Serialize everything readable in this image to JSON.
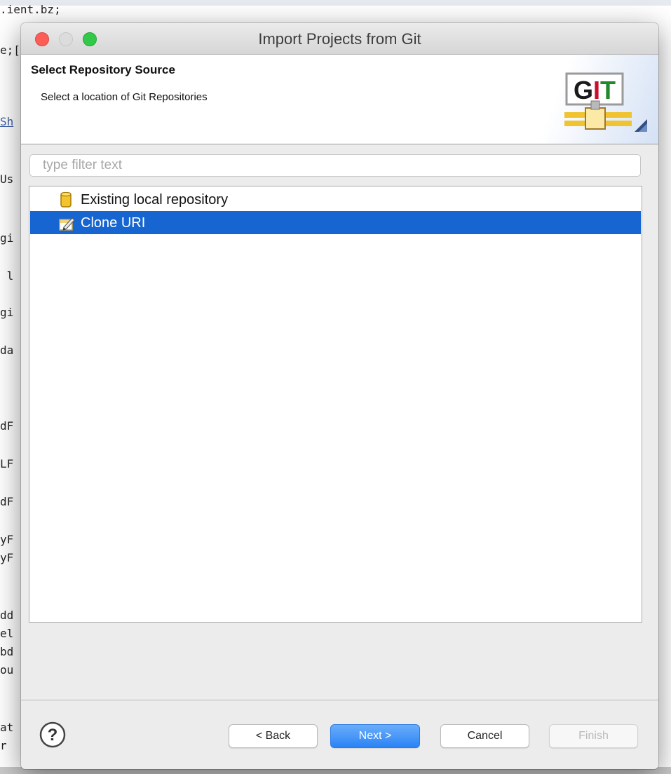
{
  "background_editor": {
    "lines": [
      ".ient.bz;",
      "e;[",
      "Sh",
      "Us",
      "gi",
      " l",
      "gi",
      "da",
      "dF",
      "LF",
      "dF",
      "yF",
      "yF",
      "dd",
      "el",
      "bd",
      "ou",
      "at",
      "r"
    ]
  },
  "window": {
    "title": "Import Projects from Git"
  },
  "header": {
    "title": "Select Repository Source",
    "description": "Select a location of Git Repositories",
    "logo_text": "GIT",
    "logo_icon": "git-pipe-logo"
  },
  "filter": {
    "placeholder": "type filter text",
    "value": ""
  },
  "tree": {
    "items": [
      {
        "label": "Existing local repository",
        "icon": "database-cylinder-icon",
        "selected": false
      },
      {
        "label": "Clone URI",
        "icon": "clone-uri-icon",
        "selected": true
      }
    ]
  },
  "footer": {
    "help_icon": "help-question-icon",
    "back_label": "< Back",
    "next_label": "Next >",
    "cancel_label": "Cancel",
    "finish_label": "Finish"
  },
  "colors": {
    "selection": "#1665d1",
    "primary_button": "#2b83f5",
    "close": "#fc5d57",
    "maximize": "#34c84a"
  }
}
